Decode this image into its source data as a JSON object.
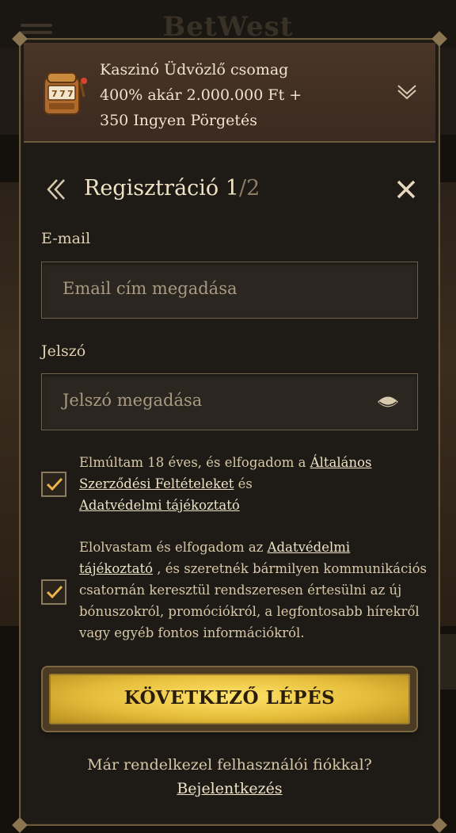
{
  "background": {
    "logo": "BetWest"
  },
  "promo": {
    "line1": "Kaszinó Üdvözlő csomag",
    "line2": "400% akár 2.000.000 Ft +",
    "line3": "350 Ingyen Pörgetés"
  },
  "header": {
    "title": "Regisztráció",
    "step_current": "1",
    "step_sep": "/",
    "step_total": "2"
  },
  "form": {
    "email_label": "E-mail",
    "email_placeholder": "Email cím megadása",
    "password_label": "Jelszó",
    "password_placeholder": "Jelszó megadása"
  },
  "consent1": {
    "checked": true,
    "text_before": "Elmúltam 18 éves, és elfogadom a ",
    "terms_link": "Általános Szerződési Feltételeket",
    "text_mid": " és ",
    "privacy_link": "Adatvédelmi tájékoztató"
  },
  "consent2": {
    "checked": true,
    "text_before": "Elolvastam és elfogadom az ",
    "privacy_link": "Adatvédelmi tájékoztató",
    "text_after": " , és szeretnék bármilyen kommunikációs csatornán keresztül rendszeresen értesülni az új bónuszokról, promóciókról, a legfontosabb hírekről vagy egyéb fontos információkról."
  },
  "next_button": {
    "label": "KÖVETKEZŐ LÉPÉS"
  },
  "footer": {
    "question": "Már rendelkezel felhasználói fiókkal?",
    "login_link": "Bejelentkezés"
  },
  "colors": {
    "accent_gold": "#f0c23a",
    "modal_bg": "#1e1b16",
    "promo_bg": "#4a3527",
    "check_color": "#e8b64a"
  }
}
